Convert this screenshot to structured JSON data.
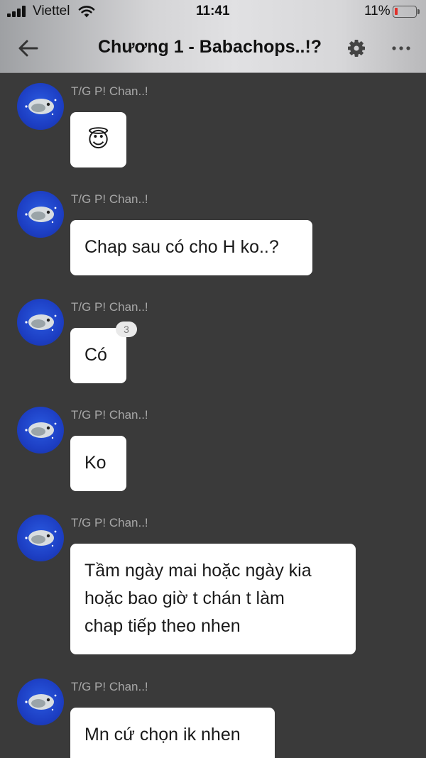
{
  "status_bar": {
    "carrier": "Viettel",
    "time": "11:41",
    "battery": "11%"
  },
  "header": {
    "title": "Chương 1 - Babachops..!?"
  },
  "messages": [
    {
      "sender": "T/G P! Chan..!",
      "text": "😇"
    },
    {
      "sender": "T/G P! Chan..!",
      "text": "Chap sau có cho H ko..?"
    },
    {
      "sender": "T/G P! Chan..!",
      "text": "Có",
      "reaction_count": "3"
    },
    {
      "sender": "T/G P! Chan..!",
      "text": "Ko"
    },
    {
      "sender": "T/G P! Chan..!",
      "lines": [
        "Tầm ngày mai hoặc ngày kia",
        "hoặc bao giờ t chán t làm",
        "chap tiếp theo nhen"
      ]
    },
    {
      "sender": "T/G P! Chan..!",
      "text": "Mn cứ chọn ik nhen"
    }
  ],
  "icons": {
    "back": "arrow-left-icon",
    "settings": "gear-icon",
    "more": "more-icon",
    "signal": "signal-icon",
    "wifi": "wifi-icon",
    "battery": "battery-icon"
  },
  "colors": {
    "background": "#3a3a3a",
    "bubble": "#ffffff",
    "avatar": "#1d3fc4",
    "battery_low": "#e0302a"
  }
}
